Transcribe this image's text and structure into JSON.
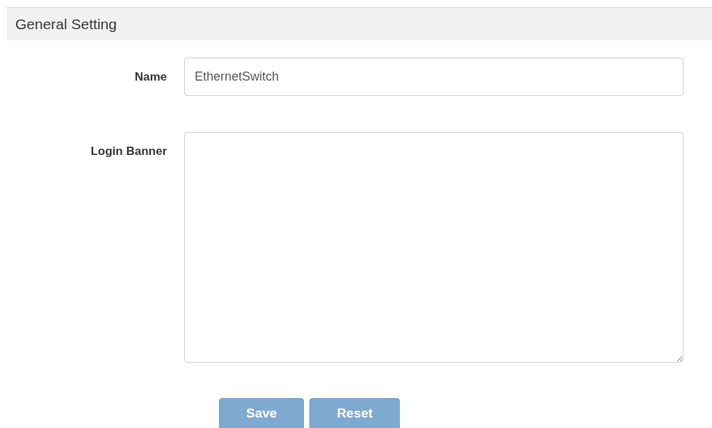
{
  "panel": {
    "title": "General Setting"
  },
  "fields": [
    {
      "kind": "input",
      "label": "Name",
      "value": "EthernetSwitch"
    },
    {
      "kind": "textarea",
      "label": "Login Banner"
    }
  ],
  "buttons": [
    {
      "label": "Save",
      "disabled": true
    },
    {
      "label": "Reset",
      "disabled": true
    }
  ]
}
